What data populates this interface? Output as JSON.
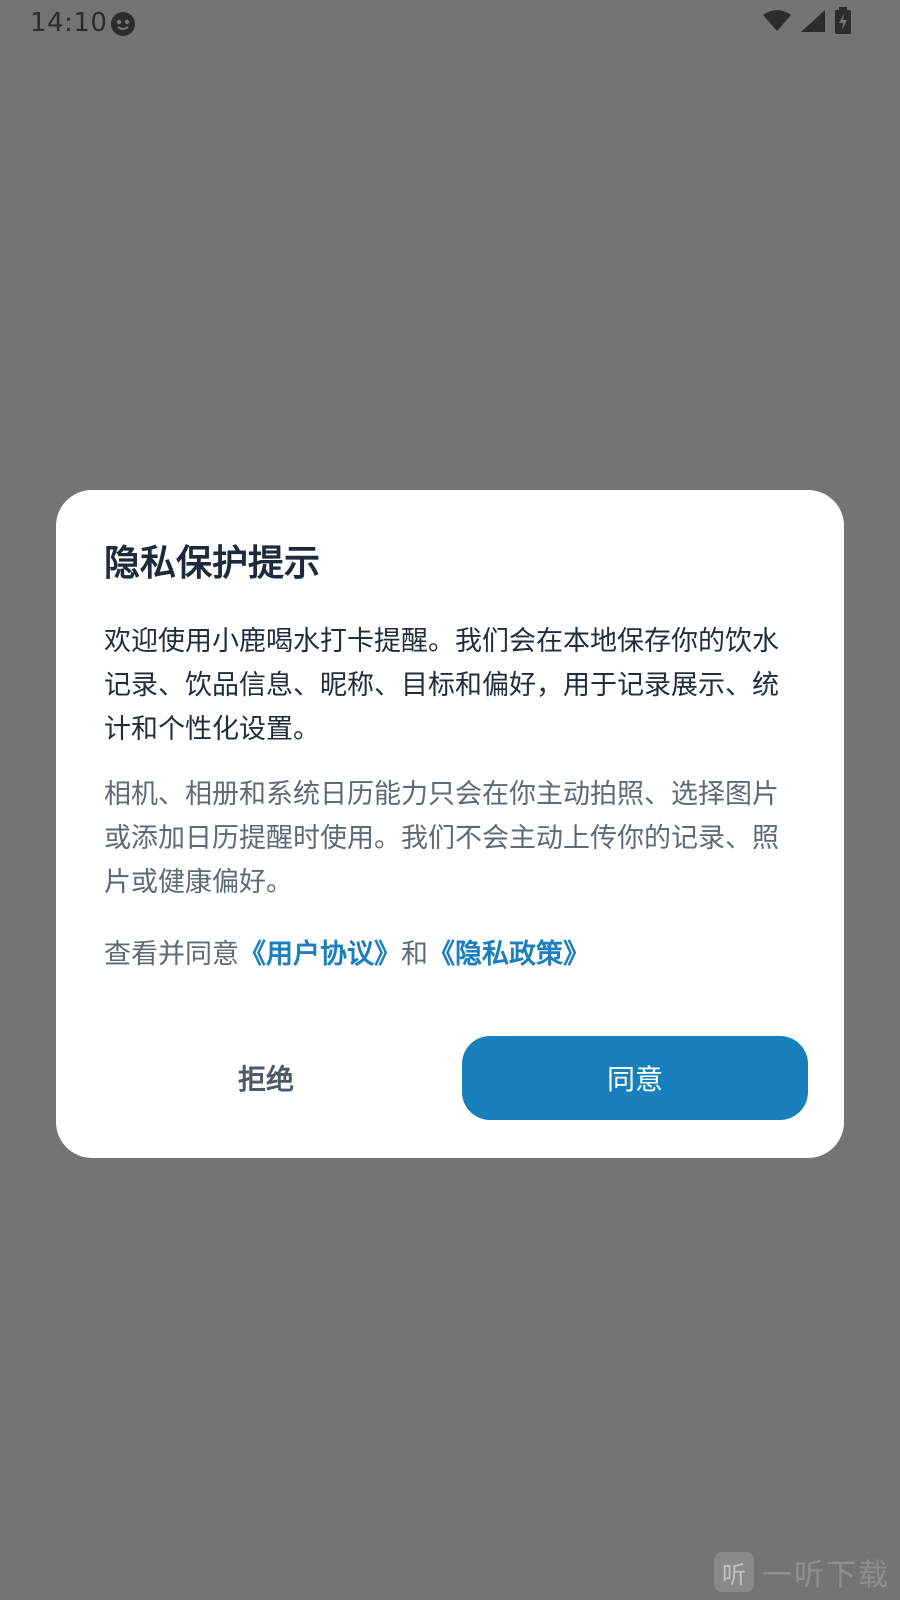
{
  "status_bar": {
    "time": "14:10",
    "icons": [
      "app-notification-icon",
      "wifi-icon",
      "cellular-signal-icon",
      "battery-charging-icon"
    ]
  },
  "dialog": {
    "title": "隐私保护提示",
    "paragraph_1": "欢迎使用小鹿喝水打卡提醒。我们会在本地保存你的饮水记录、饮品信息、昵称、目标和偏好，用于记录展示、统计和个性化设置。",
    "paragraph_2": "相机、相册和系统日历能力只会在你主动拍照、选择图片或添加日历提醒时使用。我们不会主动上传你的记录、照片或健康偏好。",
    "consent_prefix": "查看并同意",
    "user_agreement_link": "《用户协议》",
    "consent_and": "和",
    "privacy_policy_link": "《隐私政策》",
    "reject_label": "拒绝",
    "agree_label": "同意"
  },
  "watermark": {
    "badge": "听",
    "text": "一听下载"
  },
  "colors": {
    "overlay": "#737476",
    "accent": "#1780bc",
    "link": "#1a7fbd",
    "title": "#1b2a3c"
  }
}
